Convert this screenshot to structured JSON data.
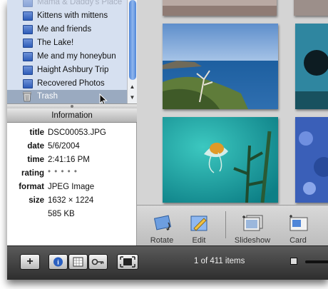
{
  "sidebar": {
    "items": [
      {
        "label": "Mama & Daddy's Place",
        "faded": true
      },
      {
        "label": "Kittens with mittens"
      },
      {
        "label": "Me and friends"
      },
      {
        "label": "The Lake!"
      },
      {
        "label": "Me and my honeybun"
      },
      {
        "label": "Haight Ashbury Trip"
      },
      {
        "label": "Recovered Photos"
      }
    ],
    "selected_label": "Trash",
    "scroll_up": "▲",
    "scroll_down": "▼"
  },
  "info": {
    "header": "Information",
    "rows": [
      {
        "label": "title",
        "value": "DSC00053.JPG"
      },
      {
        "label": "date",
        "value": "5/6/2004"
      },
      {
        "label": "time",
        "value": "2:41:16 PM"
      },
      {
        "label": "rating",
        "value": "• • • • •"
      },
      {
        "label": "format",
        "value": "JPEG Image"
      },
      {
        "label": "size",
        "value": "1632 × 1224"
      },
      {
        "label": "",
        "value": "585 KB"
      }
    ]
  },
  "toolbar": {
    "rotate": "Rotate",
    "edit": "Edit",
    "slideshow": "Slideshow",
    "card": "Card"
  },
  "bottombar": {
    "status": "1 of 411 items",
    "add": "+"
  },
  "colors": {
    "source_list_bg": "#d6e0f0",
    "selection": "#9aaac0",
    "accent_blue": "#2e5cb8"
  }
}
